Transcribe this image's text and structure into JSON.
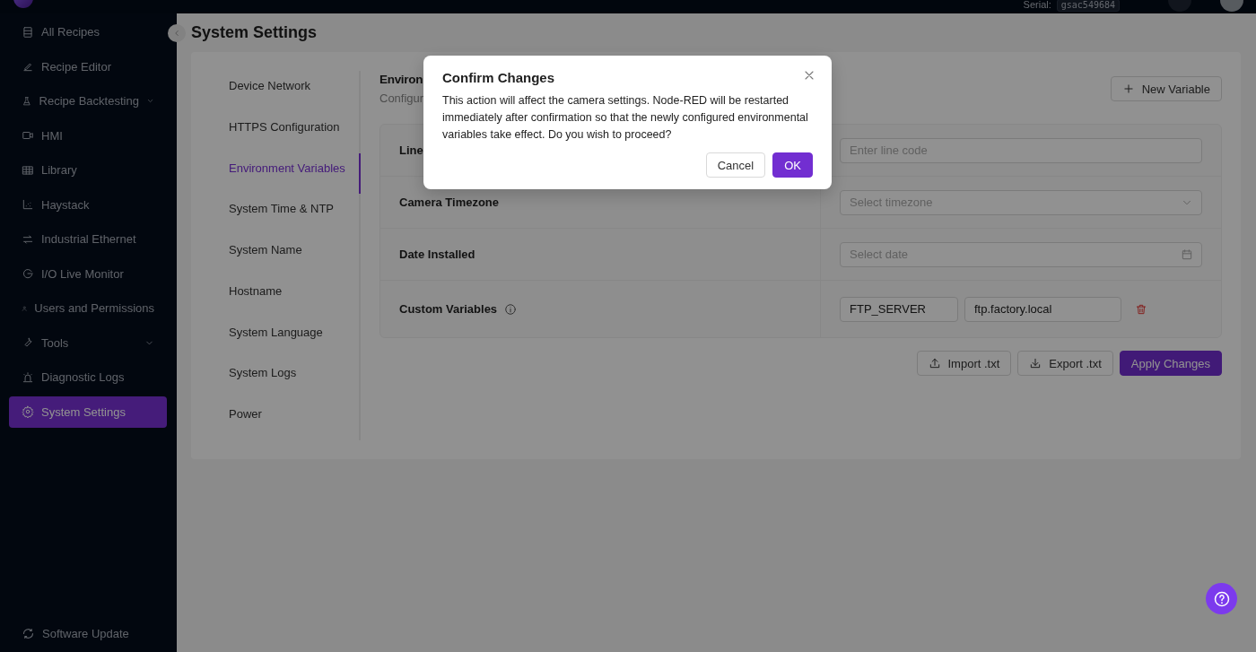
{
  "header": {
    "serial_label": "Serial:",
    "serial": "gsac549684"
  },
  "sidebar": {
    "items": [
      {
        "label": "All Recipes",
        "kind": "link",
        "selected": false
      },
      {
        "label": "Recipe Editor",
        "kind": "link",
        "selected": false
      },
      {
        "label": "Recipe Backtesting",
        "kind": "group",
        "selected": false
      },
      {
        "label": "HMI",
        "kind": "link",
        "selected": false
      },
      {
        "label": "Library",
        "kind": "link",
        "selected": false
      },
      {
        "label": "Haystack",
        "kind": "link",
        "selected": false
      },
      {
        "label": "Industrial Ethernet",
        "kind": "link",
        "selected": false
      },
      {
        "label": "I/O Live Monitor",
        "kind": "link",
        "selected": false
      },
      {
        "label": "Users and Permissions",
        "kind": "link",
        "selected": false
      },
      {
        "label": "Tools",
        "kind": "group",
        "selected": false
      },
      {
        "label": "Diagnostic Logs",
        "kind": "link",
        "selected": false
      },
      {
        "label": "System Settings",
        "kind": "link",
        "selected": true
      }
    ],
    "footer": "Software Update"
  },
  "page_title": "System Settings",
  "settings_nav": [
    {
      "label": "Device Network",
      "selected": false
    },
    {
      "label": "HTTPS Configuration",
      "selected": false
    },
    {
      "label": "Environment Variables",
      "selected": true
    },
    {
      "label": "System Time & NTP",
      "selected": false
    },
    {
      "label": "System Name",
      "selected": false
    },
    {
      "label": "Hostname",
      "selected": false
    },
    {
      "label": "System Language",
      "selected": false
    },
    {
      "label": "System Logs",
      "selected": false
    },
    {
      "label": "Power",
      "selected": false
    }
  ],
  "section": {
    "title": "Environ",
    "subtitle": "Configur",
    "new_button": "New Variable"
  },
  "rows": [
    {
      "label": "Line",
      "kind": "text",
      "placeholder": "Enter line code"
    },
    {
      "label": "Camera Timezone",
      "kind": "select",
      "placeholder": "Select timezone"
    },
    {
      "label": "Date Installed",
      "kind": "date",
      "placeholder": "Select date"
    },
    {
      "label": "Custom Variables",
      "kind": "pairs",
      "info": true,
      "pairs": [
        {
          "key": "FTP_SERVER",
          "value": "ftp.factory.local"
        }
      ]
    }
  ],
  "actions": {
    "import": "Import .txt",
    "export": "Export .txt",
    "apply": "Apply Changes"
  },
  "dialog": {
    "title": "Confirm Changes",
    "message": "This action will affect the camera settings. Node-RED will be restarted immediately after confirmation so that the newly configured environmental variables take effect. Do you wish to proceed?",
    "cancel": "Cancel",
    "ok": "OK"
  }
}
